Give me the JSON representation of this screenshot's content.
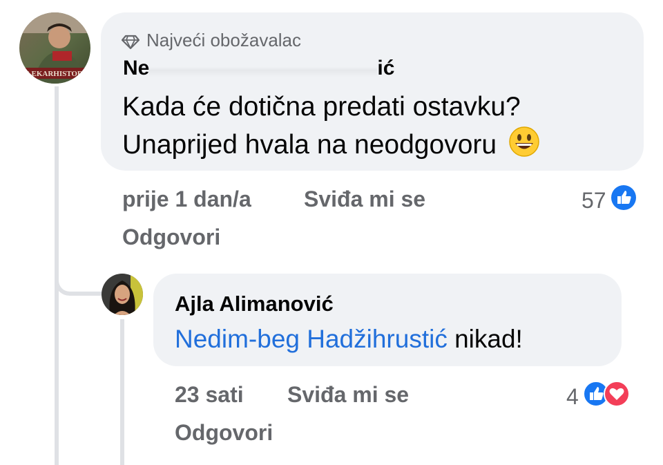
{
  "comment": {
    "badge_label": "Najveći obožavalac",
    "badge_icon": "diamond-icon",
    "author_visible_start": "Ne",
    "author_visible_end": "ić",
    "text_line1": "Kada će dotična predati ostavku?",
    "text_line2": "Unaprijed hvala na neodgovoru",
    "emoji": "😀",
    "time": "prije 1 dan/a",
    "like_label": "Sviđa mi se",
    "reply_label": "Odgovori",
    "reaction_count": "57",
    "reaction_icons": [
      "like-icon"
    ]
  },
  "reply": {
    "author": "Ajla Alimanović",
    "mention": "Nedim-beg Hadžihrustić",
    "text": " nikad!",
    "time": "23 sati",
    "like_label": "Sviđa mi se",
    "reply_label": "Odgovori",
    "reaction_count": "4",
    "reaction_icons": [
      "like-icon",
      "love-icon"
    ]
  },
  "colors": {
    "bubble": "#f0f2f5",
    "meta_text": "#65676b",
    "mention": "#216fdb",
    "like_blue": "#1877f2",
    "love_red": "#f33e58"
  }
}
